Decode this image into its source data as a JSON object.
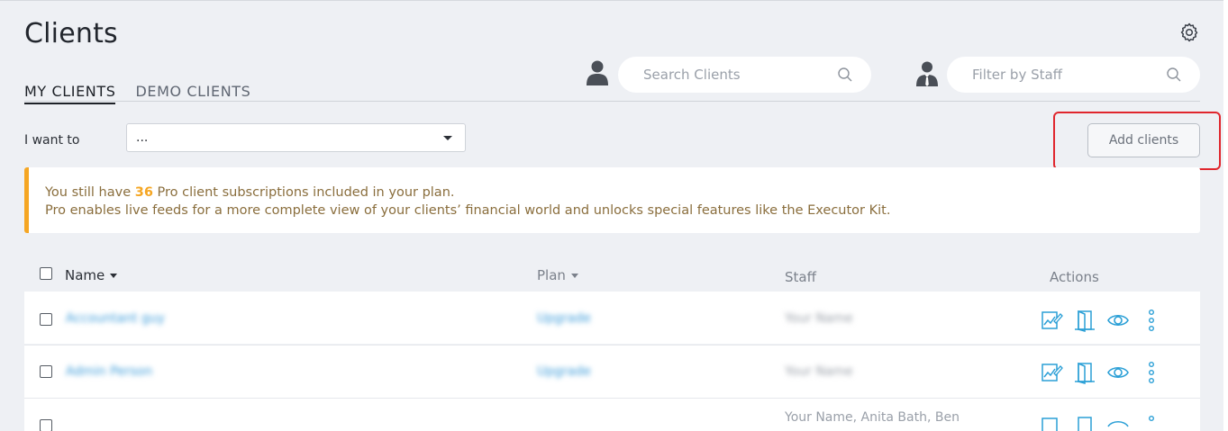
{
  "header": {
    "title": "Clients"
  },
  "tabs": [
    {
      "label": "MY CLIENTS",
      "active": true
    },
    {
      "label": "DEMO CLIENTS",
      "active": false
    }
  ],
  "search": {
    "placeholder": "Search Clients"
  },
  "staff_filter": {
    "placeholder": "Filter by Staff"
  },
  "i_want_to": {
    "label": "I want to",
    "value": "..."
  },
  "add_clients": {
    "label": "Add clients"
  },
  "banner": {
    "prefix": "You still have ",
    "count": "36",
    "suffix": " Pro client subscriptions included in your plan.",
    "line2": "Pro enables live feeds for a more complete view of your clients’ financial world and unlocks special features like the Executor Kit."
  },
  "table": {
    "columns": {
      "name": "Name",
      "plan": "Plan",
      "staff": "Staff",
      "actions": "Actions"
    },
    "rows": [
      {
        "name": "Accountant guy",
        "plan": "Upgrade",
        "staff": "Your Name"
      },
      {
        "name": "Admin Person",
        "plan": "Upgrade",
        "staff": "Your Name"
      },
      {
        "name": "",
        "plan": "",
        "staff": "Your Name, Anita Bath, Ben"
      }
    ]
  },
  "colors": {
    "accent": "#2a9fd6",
    "warning": "#f5a623",
    "highlight": "#e0262d"
  },
  "icons": [
    "gear-icon",
    "person-icon",
    "staff-icon",
    "search-icon",
    "dashboard-icon",
    "door-icon",
    "eye-icon",
    "more-vertical-icon"
  ]
}
